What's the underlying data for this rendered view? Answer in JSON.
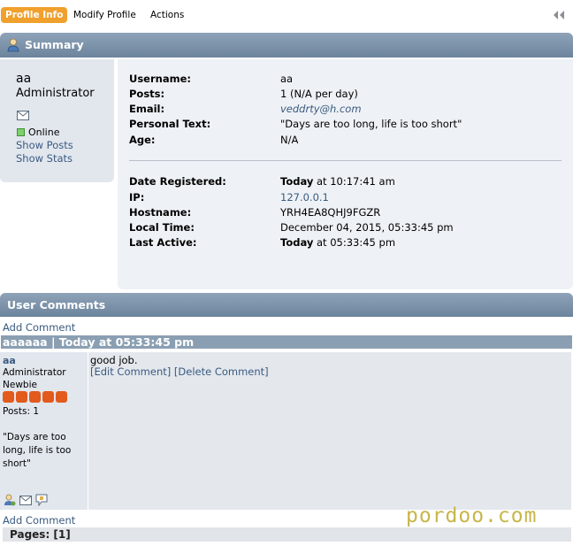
{
  "menu": {
    "tabs": [
      {
        "label": "Profile Info",
        "active": true
      },
      {
        "label": "Modify Profile",
        "active": false
      },
      {
        "label": "Actions",
        "active": false
      }
    ],
    "collapse_icon": "double-chevron-left-icon",
    "accent_color": "#f0a02c"
  },
  "summary": {
    "title": "Summary",
    "icon": "user-icon",
    "user": {
      "name": "aa",
      "group": "Administrator",
      "status": "Online",
      "status_color": "#7ed16a",
      "show_posts": "Show Posts",
      "show_stats": "Show Stats"
    },
    "fields": [
      {
        "label": "Username:",
        "value": "aa"
      },
      {
        "label": "Posts:",
        "value": "1 (N/A per day)"
      },
      {
        "label": "Email:",
        "value": "veddrty@h.com"
      },
      {
        "label": "Personal Text:",
        "value": "\"Days are too long, life is too short\""
      },
      {
        "label": "Age:",
        "value": "N/A"
      }
    ],
    "fields2": [
      {
        "label": "Date Registered:",
        "bold": "Today",
        "value": " at 10:17:41 am"
      },
      {
        "label": "IP:",
        "value": "127.0.0.1"
      },
      {
        "label": "Hostname:",
        "value": "YRH4EA8QHJ9FGZR"
      },
      {
        "label": "Local Time:",
        "value": "December 04, 2015, 05:33:45 pm"
      },
      {
        "label": "Last Active:",
        "bold": "Today",
        "value": " at 05:33:45 pm"
      }
    ]
  },
  "comments": {
    "title": "User Comments",
    "add_comment": "Add Comment",
    "items": [
      {
        "header": "aaaaaa | Today at 05:33:45 pm",
        "poster": {
          "name": "aa",
          "group": "Administrator",
          "rank": "Newbie",
          "stars": 5,
          "posts": "Posts: 1",
          "personal_text": "\"Days are too long, life is too short\""
        },
        "body": "good job.",
        "edit": "[Edit Comment]",
        "delete": "[Delete Comment]"
      }
    ],
    "pages": "Pages: [1]"
  },
  "watermark": "pordoo.com"
}
